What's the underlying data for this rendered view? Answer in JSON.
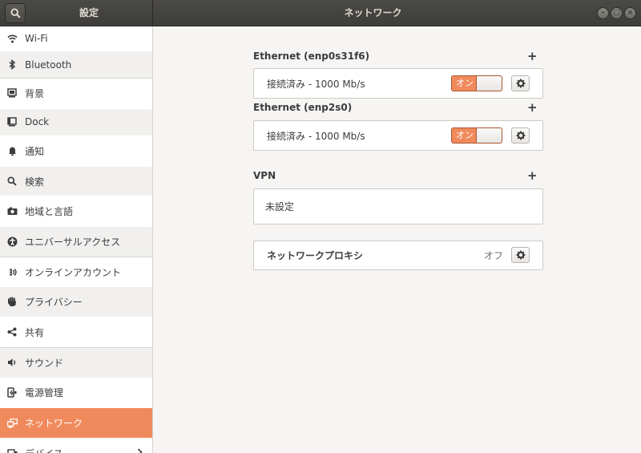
{
  "header": {
    "sidebar_title": "設定",
    "main_title": "ネットワーク",
    "wm_minimize": "–",
    "wm_maximize": "□",
    "wm_close": "×"
  },
  "sidebar": {
    "items": [
      {
        "label": "Wi-Fi",
        "icon": "wifi-icon"
      },
      {
        "label": "Bluetooth",
        "icon": "bluetooth-icon"
      },
      {
        "label": "背景",
        "icon": "background-icon"
      },
      {
        "label": "Dock",
        "icon": "dock-icon"
      },
      {
        "label": "通知",
        "icon": "bell-icon"
      },
      {
        "label": "検索",
        "icon": "search-icon"
      },
      {
        "label": "地域と言語",
        "icon": "region-icon"
      },
      {
        "label": "ユニバーサルアクセス",
        "icon": "accessibility-icon"
      },
      {
        "label": "オンラインアカウント",
        "icon": "online-accounts-icon"
      },
      {
        "label": "プライバシー",
        "icon": "hand-icon"
      },
      {
        "label": "共有",
        "icon": "share-icon"
      },
      {
        "label": "サウンド",
        "icon": "speaker-icon"
      },
      {
        "label": "電源管理",
        "icon": "power-icon"
      },
      {
        "label": "ネットワーク",
        "icon": "network-icon",
        "active": true
      },
      {
        "label": "デバイス",
        "icon": "devices-icon",
        "has_chevron": true
      }
    ]
  },
  "main": {
    "ethernet1": {
      "title": "Ethernet (enp0s31f6)",
      "status": "接続済み - 1000 Mb/s",
      "toggle_label": "オン"
    },
    "ethernet2": {
      "title": "Ethernet (enp2s0)",
      "status": "接続済み - 1000 Mb/s",
      "toggle_label": "オン"
    },
    "vpn": {
      "title": "VPN",
      "status": "未設定"
    },
    "proxy": {
      "label": "ネットワークプロキシ",
      "value": "オフ"
    }
  },
  "colors": {
    "accent": "#f08a5d",
    "headerbar": "#3e3d39",
    "background": "#f6f5f4"
  }
}
